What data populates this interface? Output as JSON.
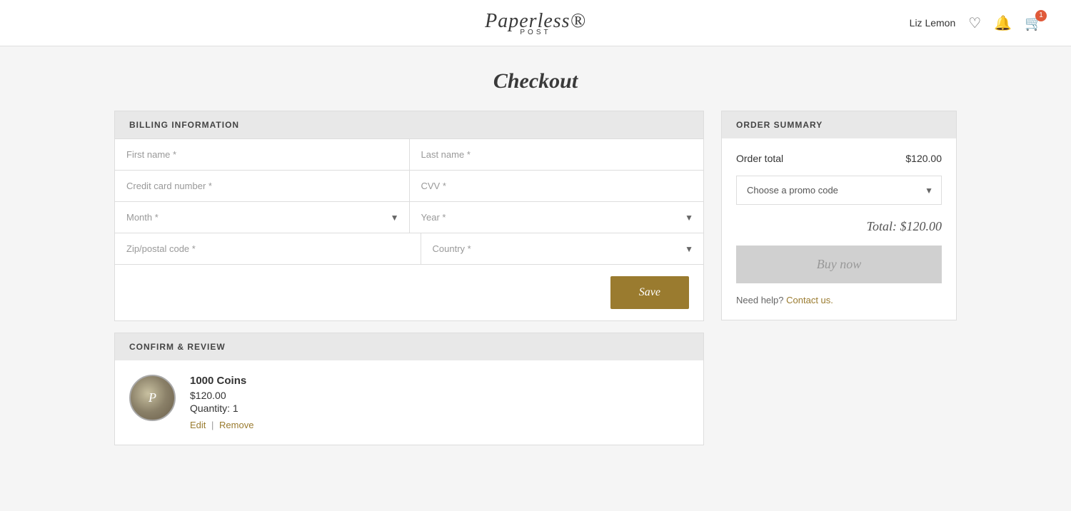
{
  "header": {
    "logo_text": "Paperless®",
    "logo_sub": "POST",
    "username": "Liz Lemon",
    "cart_count": "1"
  },
  "page": {
    "title": "Checkout"
  },
  "billing": {
    "section_label": "BILLING INFORMATION",
    "first_name_placeholder": "First name *",
    "last_name_placeholder": "Last name *",
    "credit_card_placeholder": "Credit card number *",
    "cvv_placeholder": "CVV *",
    "month_placeholder": "Month *",
    "year_placeholder": "Year *",
    "zip_placeholder": "Zip/postal code *",
    "country_placeholder": "Country *",
    "save_label": "Save"
  },
  "review": {
    "section_label": "CONFIRM & REVIEW",
    "product_logo": "P",
    "product_name": "1000 Coins",
    "product_price": "$120.00",
    "product_quantity": "Quantity: 1",
    "edit_label": "Edit",
    "remove_label": "Remove"
  },
  "order_summary": {
    "section_label": "ORDER SUMMARY",
    "order_total_label": "Order total",
    "order_total_value": "$120.00",
    "promo_placeholder": "Choose a promo code",
    "total_label": "Total: $120.00",
    "buy_now_label": "Buy now",
    "need_help_text": "Need help?",
    "contact_us_text": "Contact us."
  }
}
